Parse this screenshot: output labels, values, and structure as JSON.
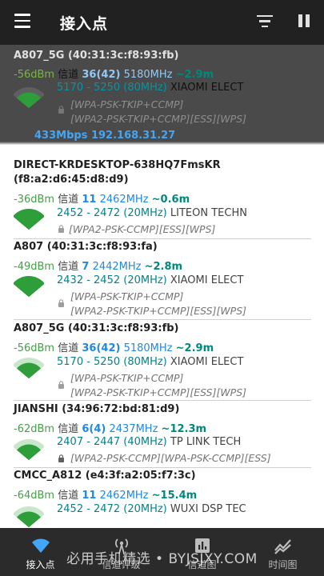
{
  "appbar": {
    "title": "接入点",
    "icons": [
      "menu-icon",
      "filter-icon",
      "pause-icon"
    ]
  },
  "connected": {
    "ssid": "A807_5G (40:31:3c:f8:93:fb)",
    "level": "-56dBm",
    "channel_label": "信道",
    "channel": "36(42)",
    "frequency": "5180MHz",
    "distance": "~2.9m",
    "range": "5170 - 5250 (80MHz)",
    "vendor": "XIAOMI ELECT",
    "security": [
      "[WPA-PSK-TKIP+CCMP]",
      "[WPA2-PSK-TKIP+CCMP][ESS][WPS]"
    ],
    "link_speed": "433Mbps",
    "ip": "192.168.31.27",
    "signal_bars": 3
  },
  "access_points": [
    {
      "ssid": "DIRECT-KRDESKTOP-638HQ7FmsKR",
      "bssid": "(f8:a2:d6:45:d8:d9)",
      "level": "-36dBm",
      "channel_label": "信道",
      "channel": "11",
      "frequency": "2462MHz",
      "distance": "~0.6m",
      "range": "2452 - 2472 (20MHz)",
      "vendor": "LITEON TECHN",
      "security": [
        "[WPA2-PSK-CCMP][ESS][WPS]"
      ],
      "signal_bars": 4
    },
    {
      "ssid": "A807 (40:31:3c:f8:93:fa)",
      "level": "-49dBm",
      "channel_label": "信道",
      "channel": "7",
      "frequency": "2442MHz",
      "distance": "~2.8m",
      "range": "2432 - 2452 (20MHz)",
      "vendor": "XIAOMI ELECT",
      "security": [
        "[WPA-PSK-TKIP+CCMP]",
        "[WPA2-PSK-TKIP+CCMP][ESS][WPS]"
      ],
      "signal_bars": 4
    },
    {
      "ssid": "A807_5G (40:31:3c:f8:93:fb)",
      "level": "-56dBm",
      "channel_label": "信道",
      "channel": "36(42)",
      "frequency": "5180MHz",
      "distance": "~2.9m",
      "range": "5170 - 5250 (80MHz)",
      "vendor": "XIAOMI ELECT",
      "security": [
        "[WPA-PSK-TKIP+CCMP]",
        "[WPA2-PSK-TKIP+CCMP][ESS][WPS]"
      ],
      "signal_bars": 3
    },
    {
      "ssid": "JIANSHI (34:96:72:bd:81:d9)",
      "level": "-62dBm",
      "channel_label": "信道",
      "channel": "6(4)",
      "frequency": "2437MHz",
      "distance": "~12.3m",
      "range": "2407 - 2447 (40MHz)",
      "vendor": "TP LINK TECH",
      "security": [
        "[WPA2-PSK-CCMP][WPA-PSK-CCMP][ESS]"
      ],
      "signal_bars": 3
    },
    {
      "ssid": "CMCC_A812 (e4:3f:a2:05:f7:3c)",
      "level": "-64dBm",
      "channel_label": "信道",
      "channel": "11",
      "frequency": "2462MHz",
      "distance": "~15.4m",
      "range": "2452 - 2472 (20MHz)",
      "vendor": "WUXI DSP TEC",
      "security": [],
      "signal_bars": 3
    }
  ],
  "bottom_nav": [
    {
      "label": "接入点",
      "icon": "wifi-icon",
      "active": true
    },
    {
      "label": "信道评级",
      "icon": "signal-tower-icon",
      "active": false
    },
    {
      "label": "信道图",
      "icon": "channel-graph-icon",
      "active": false
    },
    {
      "label": "时间图",
      "icon": "time-graph-icon",
      "active": false
    }
  ],
  "watermark": "必用手机精选 • BYJSJXY.COM",
  "colors": {
    "appbar": "#212121",
    "connected_bg": "#4a4a4a",
    "signal_green": "#2e9e3a",
    "level_green": "#43a047",
    "channel_blue": "#1e88e5",
    "distance_teal": "#00897b",
    "nav_bg": "#2b2b2b",
    "nav_active": "#42a5f5"
  }
}
